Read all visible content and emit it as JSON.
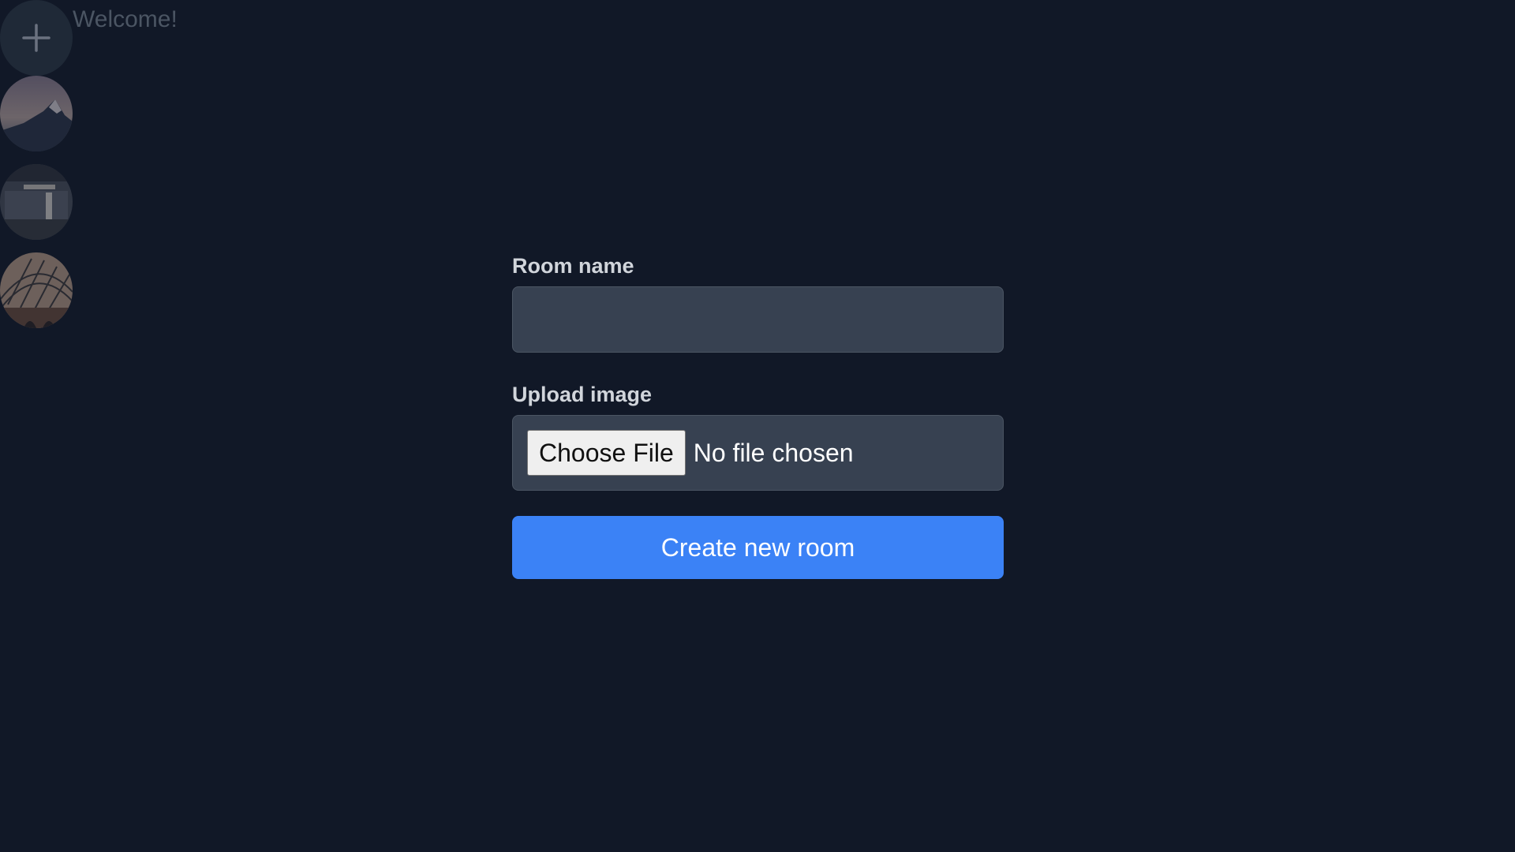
{
  "header": {
    "welcome": "Welcome!"
  },
  "sidebar": {
    "add_icon": "plus-icon",
    "rooms": [
      {
        "icon": "mountain-photo"
      },
      {
        "icon": "interior-photo"
      },
      {
        "icon": "arch-building-photo"
      }
    ]
  },
  "form": {
    "room_name_label": "Room name",
    "room_name_value": "",
    "upload_label": "Upload image",
    "choose_file_label": "Choose File",
    "file_status": "No file chosen",
    "submit_label": "Create new room"
  },
  "colors": {
    "background": "#111827",
    "input_bg": "#374151",
    "accent": "#3b82f6"
  }
}
